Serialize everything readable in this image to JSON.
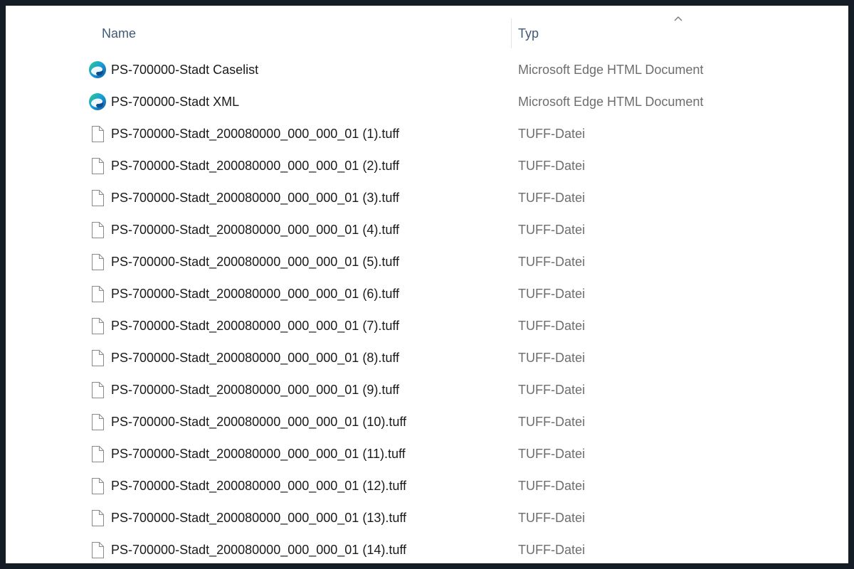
{
  "header": {
    "name_label": "Name",
    "type_label": "Typ",
    "sort_icon": "chevron-up-icon"
  },
  "colors": {
    "header_text": "#3f5a78",
    "name_text": "#1a1a1a",
    "type_text": "#6d6d6d",
    "background": "#ffffff",
    "frame": "#141c26"
  },
  "files": [
    {
      "name": "PS-700000-Stadt Caselist",
      "type": "Microsoft Edge HTML Document",
      "icon": "edge-icon"
    },
    {
      "name": "PS-700000-Stadt XML",
      "type": "Microsoft Edge HTML Document",
      "icon": "edge-icon"
    },
    {
      "name": "PS-700000-Stadt_200080000_000_000_01 (1).tuff",
      "type": "TUFF-Datei",
      "icon": "file-icon"
    },
    {
      "name": "PS-700000-Stadt_200080000_000_000_01 (2).tuff",
      "type": "TUFF-Datei",
      "icon": "file-icon"
    },
    {
      "name": "PS-700000-Stadt_200080000_000_000_01 (3).tuff",
      "type": "TUFF-Datei",
      "icon": "file-icon"
    },
    {
      "name": "PS-700000-Stadt_200080000_000_000_01 (4).tuff",
      "type": "TUFF-Datei",
      "icon": "file-icon"
    },
    {
      "name": "PS-700000-Stadt_200080000_000_000_01 (5).tuff",
      "type": "TUFF-Datei",
      "icon": "file-icon"
    },
    {
      "name": "PS-700000-Stadt_200080000_000_000_01 (6).tuff",
      "type": "TUFF-Datei",
      "icon": "file-icon"
    },
    {
      "name": "PS-700000-Stadt_200080000_000_000_01 (7).tuff",
      "type": "TUFF-Datei",
      "icon": "file-icon"
    },
    {
      "name": "PS-700000-Stadt_200080000_000_000_01 (8).tuff",
      "type": "TUFF-Datei",
      "icon": "file-icon"
    },
    {
      "name": "PS-700000-Stadt_200080000_000_000_01 (9).tuff",
      "type": "TUFF-Datei",
      "icon": "file-icon"
    },
    {
      "name": "PS-700000-Stadt_200080000_000_000_01 (10).tuff",
      "type": "TUFF-Datei",
      "icon": "file-icon"
    },
    {
      "name": "PS-700000-Stadt_200080000_000_000_01 (11).tuff",
      "type": "TUFF-Datei",
      "icon": "file-icon"
    },
    {
      "name": "PS-700000-Stadt_200080000_000_000_01 (12).tuff",
      "type": "TUFF-Datei",
      "icon": "file-icon"
    },
    {
      "name": "PS-700000-Stadt_200080000_000_000_01 (13).tuff",
      "type": "TUFF-Datei",
      "icon": "file-icon"
    },
    {
      "name": "PS-700000-Stadt_200080000_000_000_01 (14).tuff",
      "type": "TUFF-Datei",
      "icon": "file-icon"
    }
  ]
}
